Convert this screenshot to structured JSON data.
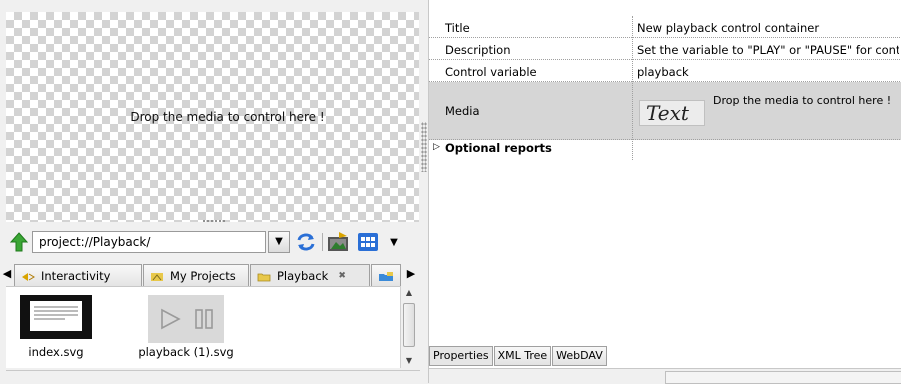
{
  "canvas": {
    "drop_hint": "Drop the media to control here !"
  },
  "browser": {
    "path": "project://Playback/",
    "tabs": [
      {
        "label": "Interactivity",
        "icon": "interactivity-icon"
      },
      {
        "label": "My Projects",
        "icon": "my-projects-icon"
      },
      {
        "label": "Playback",
        "icon": "folder-icon",
        "active": true
      }
    ],
    "files": [
      {
        "name": "index.svg",
        "icon": "svg-document-thumbnail"
      },
      {
        "name": "playback (1).svg",
        "icon": "playback-control-thumbnail",
        "selected": true
      }
    ]
  },
  "properties": {
    "rows": [
      {
        "name": "Title",
        "value": "New playback control container"
      },
      {
        "name": "Description",
        "value": "Set the variable to \"PLAY\" or \"PAUSE\" for control"
      },
      {
        "name": "Control variable",
        "value": "playback"
      },
      {
        "name": "Media",
        "value": ""
      }
    ],
    "media_chip": "Text",
    "media_drop_hint": "Drop the media to control here !",
    "optional_section": "Optional reports"
  },
  "bottom_tabs": [
    "Properties",
    "XML Tree",
    "WebDAV"
  ],
  "colors": {
    "accent_green": "#3aa635",
    "selection_gray": "#d6d6d6"
  }
}
